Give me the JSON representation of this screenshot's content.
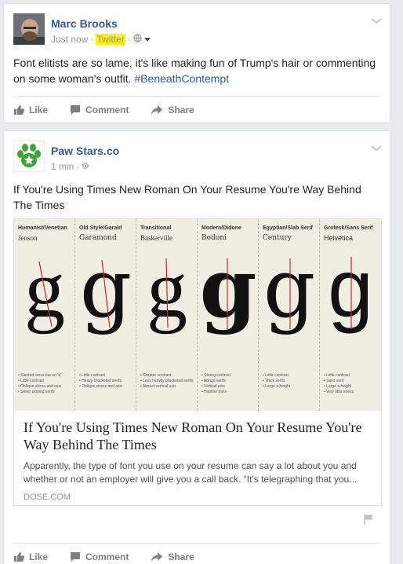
{
  "colors": {
    "link": "#365899",
    "muted": "#90949c",
    "highlight": "#fff200"
  },
  "post1": {
    "author": "Marc Brooks",
    "time": "Just now",
    "source": "Twitter",
    "dot": "·",
    "text": "Font elitists are so lame, it's like making fun of Trump's hair or commenting on some woman's outfit. ",
    "hashtag": "#BeneathContempt",
    "actions": {
      "like": "Like",
      "comment": "Comment",
      "share": "Share"
    },
    "icons": [
      "globe-icon",
      "chevron-down-icon"
    ]
  },
  "post2": {
    "author": "Paw Stars.co",
    "time": "1 min",
    "dot": "·",
    "text": "If You're Using Times New Roman On Your Resume You're Way Behind The Times",
    "link_preview": {
      "columns": [
        {
          "category": "Humanist/Venetian",
          "font": "Jenson",
          "notes": [
            "• Slanted cross bar on 'e'",
            "• Little contrast",
            "• Oblique stress and axis",
            "• Steep sloping serifs"
          ]
        },
        {
          "category": "Old Style/Garald",
          "font": "Garamond",
          "notes": [
            "• Little contrast",
            "• Heavy bracketed serifs",
            "• Oblique stress and axis"
          ]
        },
        {
          "category": "Transitional",
          "font": "Baskerville",
          "notes": [
            "• Greater contrast",
            "• Less heavily bracketed serifs",
            "• Almost vertical axis"
          ]
        },
        {
          "category": "Modern/Didone",
          "font": "Bodoni",
          "notes": [
            "• Strong contrast",
            "• Abrupt serifs",
            "• Vertical axis",
            "• Hairline thins"
          ]
        },
        {
          "category": "Egyptian/Slab Serif",
          "font": "Century",
          "notes": [
            "• Little contrast",
            "• Thick serifs",
            "• Large x-height"
          ]
        },
        {
          "category": "Grotesk/Sans Serif",
          "font": "Helvetica",
          "notes": [
            "• Little contrast",
            "• Sans serif",
            "• Large x-height",
            "• Very little stress"
          ]
        }
      ],
      "glyph": "g",
      "title": "If You're Using Times New Roman On Your Resume You're Way Behind The Times",
      "description": "Apparently, the type of font you use on your resume can say a lot about you and whether or not an employer will give you a call back. “It's telegraphing that you...",
      "domain": "DOSE.COM"
    },
    "actions": {
      "like": "Like",
      "comment": "Comment",
      "share": "Share"
    },
    "icons": [
      "gear-icon",
      "chevron-down-icon",
      "flag-icon"
    ]
  }
}
